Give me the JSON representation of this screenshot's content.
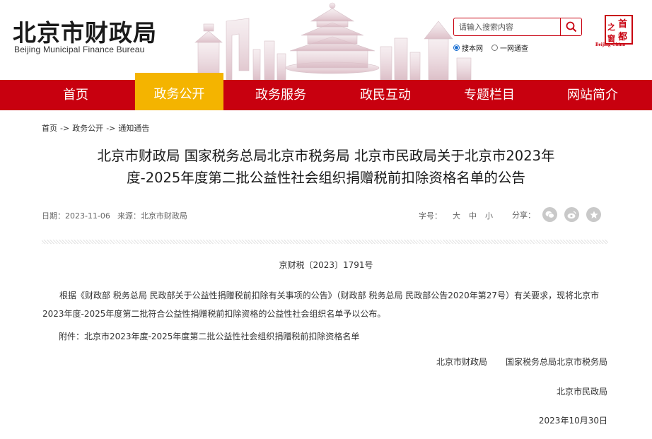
{
  "header": {
    "site_title": "北京市财政局",
    "site_subtitle": "Beijing Municipal Finance Bureau",
    "search_placeholder": "请输入搜索内容",
    "scope_options": [
      {
        "label": "搜本网",
        "checked": true
      },
      {
        "label": "一网通查",
        "checked": false
      }
    ],
    "seal_text": "首都之窗",
    "seal_caption": "Beijing-China"
  },
  "nav": {
    "items": [
      {
        "label": "首页",
        "active": false
      },
      {
        "label": "政务公开",
        "active": true
      },
      {
        "label": "政务服务",
        "active": false
      },
      {
        "label": "政民互动",
        "active": false
      },
      {
        "label": "专题栏目",
        "active": false
      },
      {
        "label": "网站简介",
        "active": false
      }
    ],
    "bar_color": "#c8000f",
    "active_color": "#f4b400"
  },
  "breadcrumb": {
    "items": [
      "首页",
      "政务公开",
      "通知通告"
    ],
    "separator": "->"
  },
  "article": {
    "title_line1": "北京市财政局 国家税务总局北京市税务局 北京市民政局关于北京市2023年",
    "title_line2": "度-2025年度第二批公益性社会组织捐赠税前扣除资格名单的公告",
    "date_label": "日期：",
    "date": "2023-11-06",
    "source_label": "来源：",
    "source": "北京市财政局",
    "fontsize_label": "字号：",
    "fontsize_options": [
      "大",
      "中",
      "小"
    ],
    "share_label": "分享：",
    "share_icons": [
      "wechat-icon",
      "weibo-icon",
      "favorite-icon"
    ],
    "doc_number": "京财税〔2023〕1791号",
    "body": "根据《财政部 税务总局 民政部关于公益性捐赠税前扣除有关事项的公告》（财政部 税务总局 民政部公告2020年第27号）有关要求，现将北京市2023年度-2025年度第二批符合公益性捐赠税前扣除资格的公益性社会组织名单予以公布。",
    "attachment": "附件：北京市2023年度-2025年度第二批公益性社会组织捐赠税前扣除资格名单",
    "signers": [
      "北京市财政局",
      "国家税务总局北京市税务局",
      "北京市民政局"
    ],
    "sign_date": "2023年10月30日"
  }
}
